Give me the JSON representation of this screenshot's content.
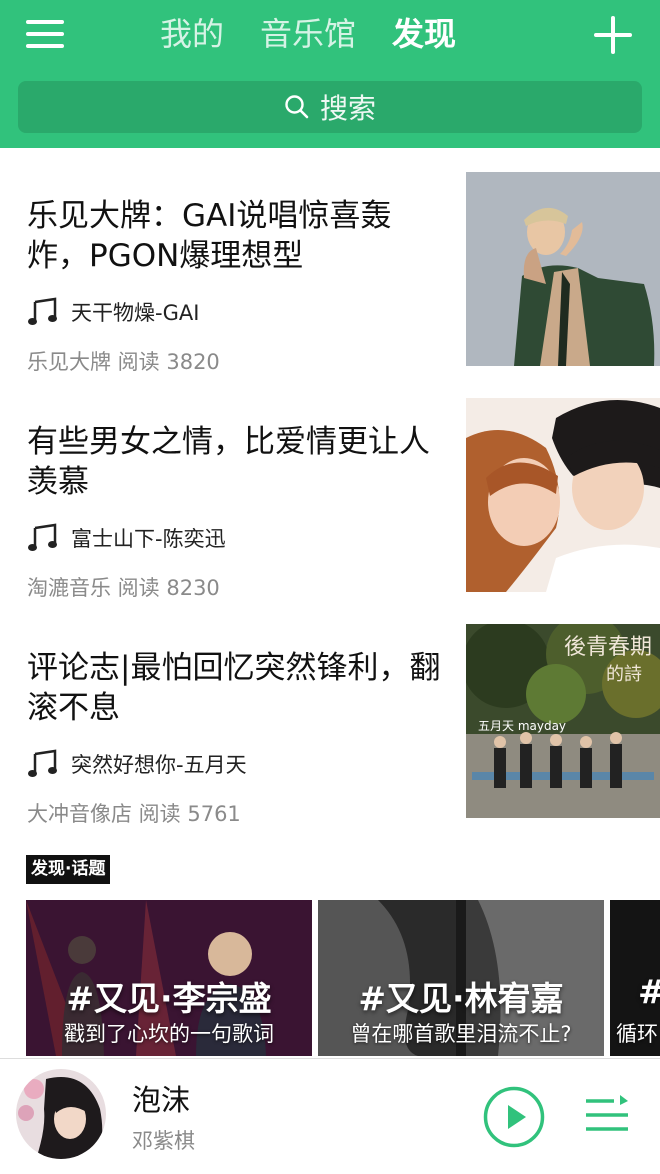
{
  "header": {
    "tabs": [
      "我的",
      "音乐馆",
      "发现"
    ],
    "active_tab": "发现",
    "search_label": "搜索"
  },
  "articles": [
    {
      "title": "乐见大牌：GAI说唱惊喜轰炸，PGON爆理想型",
      "song": "天干物燥-GAI",
      "meta": "乐见大牌 阅读 3820"
    },
    {
      "title": "有些男女之情，比爱情更让人羡慕",
      "song": "富士山下-陈奕迅",
      "meta": "淘漉音乐 阅读 8230"
    },
    {
      "title": "评论志|最怕回忆突然锋利，翻滚不息",
      "song": "突然好想你-五月天",
      "meta": "大冲音像店 阅读 5761",
      "thumb_text": {
        "title": "後青春期",
        "title2": "的詩",
        "band": "五月天 mayday"
      }
    }
  ],
  "topics_section": {
    "label": "发现·话题",
    "items": [
      {
        "title": "#又见·李宗盛",
        "subtitle": "戳到了心坎的一句歌词"
      },
      {
        "title": "#又见·林宥嘉",
        "subtitle": "曾在哪首歌里泪流不止?"
      },
      {
        "title": "#",
        "subtitle": "循环"
      }
    ]
  },
  "player": {
    "song": "泡沫",
    "singer": "邓紫棋"
  },
  "colors": {
    "brand_green": "#31c27c",
    "search_bg": "#2aa96b"
  },
  "icons": [
    "menu-icon",
    "add-icon",
    "search-icon",
    "music-note-icon",
    "play-icon",
    "playlist-icon"
  ]
}
